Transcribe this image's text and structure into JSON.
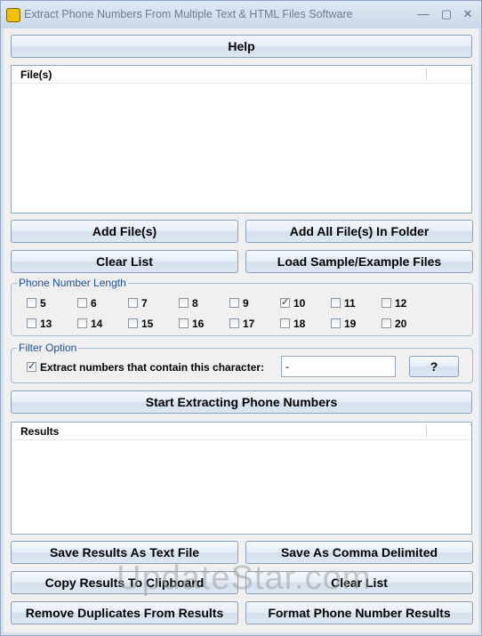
{
  "window": {
    "title": "Extract Phone Numbers From Multiple Text & HTML Files Software",
    "minimize_symbol": "—",
    "restore_symbol": "▢",
    "close_symbol": "✕"
  },
  "buttons": {
    "help": "Help",
    "add_files": "Add File(s)",
    "add_folder": "Add All File(s) In Folder",
    "clear_list": "Clear List",
    "load_sample": "Load Sample/Example Files",
    "question": "?",
    "start": "Start Extracting Phone Numbers",
    "save_text": "Save Results As Text File",
    "save_comma": "Save As Comma Delimited",
    "copy_clipboard": "Copy Results To Clipboard",
    "clear_results": "Clear List",
    "remove_duplicates": "Remove Duplicates From Results",
    "format_results": "Format Phone Number Results"
  },
  "files_list": {
    "header": "File(s)"
  },
  "phone_length": {
    "label": "Phone Number Length",
    "options": [
      {
        "value": "5",
        "checked": false
      },
      {
        "value": "6",
        "checked": false
      },
      {
        "value": "7",
        "checked": false
      },
      {
        "value": "8",
        "checked": false
      },
      {
        "value": "9",
        "checked": false
      },
      {
        "value": "10",
        "checked": true
      },
      {
        "value": "11",
        "checked": false
      },
      {
        "value": "12",
        "checked": false
      },
      {
        "value": "13",
        "checked": false
      },
      {
        "value": "14",
        "checked": false
      },
      {
        "value": "15",
        "checked": false
      },
      {
        "value": "16",
        "checked": false
      },
      {
        "value": "17",
        "checked": false
      },
      {
        "value": "18",
        "checked": false
      },
      {
        "value": "19",
        "checked": false
      },
      {
        "value": "20",
        "checked": false
      }
    ]
  },
  "filter": {
    "label": "Filter Option",
    "checkbox_label": "Extract numbers that contain this character:",
    "checked": true,
    "character_value": "-"
  },
  "results_list": {
    "header": "Results"
  },
  "watermark": "UpdateStar.com"
}
